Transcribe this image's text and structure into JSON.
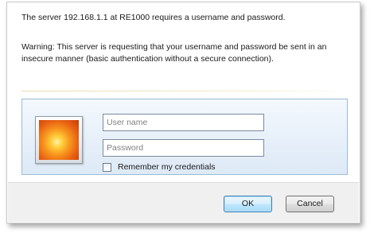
{
  "dialog": {
    "message": "The server 192.168.1.1 at RE1000 requires a username and password.",
    "warning": "Warning: This server is requesting that your username and password be sent in an insecure manner (basic authentication without a secure connection)."
  },
  "credentials": {
    "avatar_icon": "user-flower-icon",
    "username_placeholder": "User name",
    "password_placeholder": "Password",
    "remember_label": "Remember my credentials",
    "remember_checked": false
  },
  "buttons": {
    "ok_label": "OK",
    "cancel_label": "Cancel"
  },
  "colors": {
    "panel_border": "#9cbad8",
    "ok_border": "#3c7fb1"
  }
}
